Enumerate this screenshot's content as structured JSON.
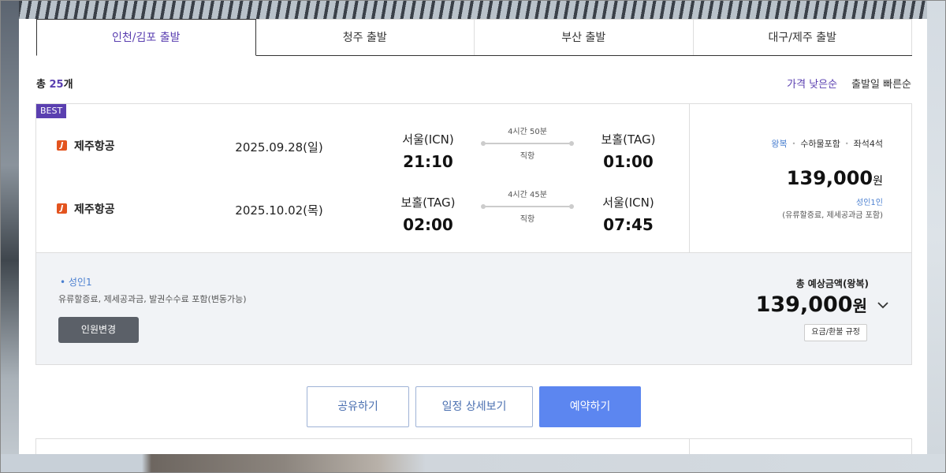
{
  "tabs": [
    {
      "label": "인천/김포 출발",
      "active": true
    },
    {
      "label": "청주 출발",
      "active": false
    },
    {
      "label": "부산 출발",
      "active": false
    },
    {
      "label": "대구/제주 출발",
      "active": false
    }
  ],
  "results": {
    "prefix": "총 ",
    "count": "25",
    "suffix": "개"
  },
  "sort": {
    "price_low": "가격 낮은순",
    "departure_fast": "출발일 빠른순"
  },
  "card": {
    "badge": "BEST",
    "segments": [
      {
        "airline": "제주항공",
        "airline_logo": "J",
        "date": "2025.09.28(일)",
        "dep_city": "서울(ICN)",
        "dep_time": "21:10",
        "duration": "4시간 50분",
        "type": "직항",
        "arr_city": "보홀(TAG)",
        "arr_time": "01:00"
      },
      {
        "airline": "제주항공",
        "airline_logo": "J",
        "date": "2025.10.02(목)",
        "dep_city": "보홀(TAG)",
        "dep_time": "02:00",
        "duration": "4시간 45분",
        "type": "직항",
        "arr_city": "서울(ICN)",
        "arr_time": "07:45"
      }
    ],
    "fare": {
      "trip": "왕복",
      "baggage": "수하물포함",
      "seats": "좌석4석",
      "price": "139,000",
      "currency": "원",
      "pax": "성인1인",
      "includes": "(유류할증료, 제세공과금 포함)"
    },
    "summary": {
      "pax": "성인1",
      "note": "유류할증료, 제세공과금, 발권수수료 포함(변동가능)",
      "change_button": "인원변경",
      "total_label": "총 예상금액(왕복)",
      "total_price": "139,000",
      "currency": "원",
      "rules_button": "요금/환불 규정"
    }
  },
  "actions": {
    "share": "공유하기",
    "detail": "일정 상세보기",
    "book": "예약하기"
  },
  "colors": {
    "accent": "#5a3fb0",
    "link_blue": "#4a7fd0",
    "book_button": "#5c86f0",
    "airline_logo": "#e3541f"
  }
}
